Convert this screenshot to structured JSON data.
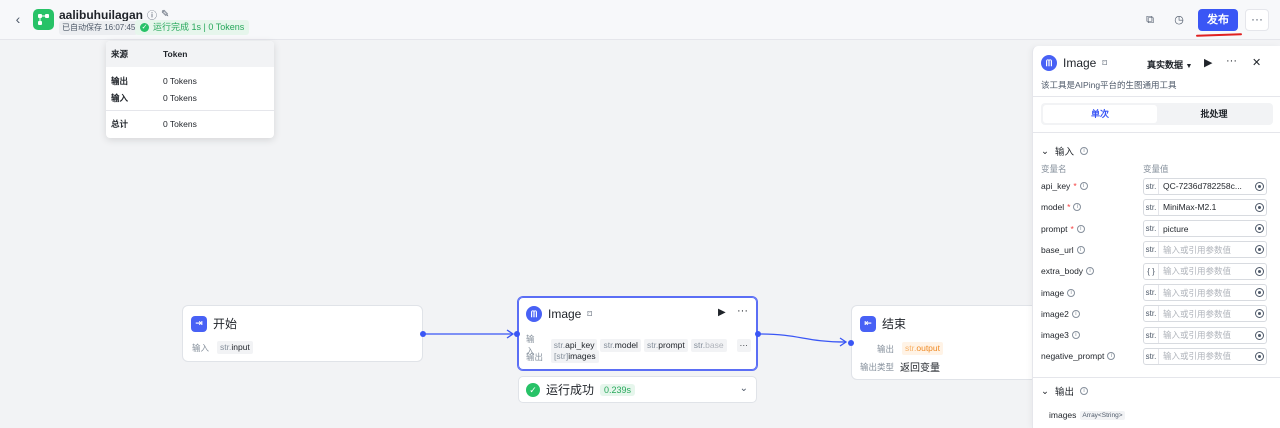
{
  "header": {
    "title": "aalibuhuilagan",
    "autosave": "已自动保存 16:07:45",
    "run_status": "运行完成 1s | 0 Tokens",
    "publish_label": "发布"
  },
  "token_popover": {
    "col_source": "来源",
    "col_token": "Token",
    "rows": [
      {
        "label": "输出",
        "value": "0 Tokens"
      },
      {
        "label": "输入",
        "value": "0 Tokens"
      }
    ],
    "total_label": "总计",
    "total_value": "0 Tokens"
  },
  "nodes": {
    "start": {
      "title": "开始",
      "input_label": "输入",
      "input_param": {
        "type": "str.",
        "name": "input"
      }
    },
    "image": {
      "title": "Image",
      "input_label": "输入",
      "output_label": "输出",
      "inputs": [
        {
          "type": "str.",
          "name": "api_key"
        },
        {
          "type": "str.",
          "name": "model"
        },
        {
          "type": "str.",
          "name": "prompt"
        },
        {
          "type": "str.",
          "name": "base"
        }
      ],
      "more": "···",
      "output": {
        "type": "[str]",
        "name": "images"
      }
    },
    "end": {
      "title": "结束",
      "output_label": "输出",
      "output_param": {
        "type": "str.",
        "name": "output"
      },
      "output_type_label": "输出类型",
      "output_type_value": "返回变量"
    }
  },
  "run_result": {
    "label": "运行成功",
    "time": "0.239s"
  },
  "panel": {
    "title": "Image",
    "data_mode": "真实数据",
    "description": "该工具是AIPing平台的生图通用工具",
    "tabs": [
      "单次",
      "批处理"
    ],
    "active_tab": 0,
    "input_section": "输入",
    "col_name": "变量名",
    "col_value": "变量值",
    "params": [
      {
        "name": "api_key",
        "required": true,
        "type": "str.",
        "value": "QC-7236d782258c...",
        "placeholder": ""
      },
      {
        "name": "model",
        "required": true,
        "type": "str.",
        "value": "MiniMax-M2.1",
        "placeholder": ""
      },
      {
        "name": "prompt",
        "required": true,
        "type": "str.",
        "value": "picture",
        "placeholder": ""
      },
      {
        "name": "base_url",
        "required": false,
        "type": "str.",
        "value": "",
        "placeholder": "输入或引用参数值"
      },
      {
        "name": "extra_body",
        "required": false,
        "type": "{ }",
        "value": "",
        "placeholder": "输入或引用参数值"
      },
      {
        "name": "image",
        "required": false,
        "type": "str.",
        "value": "",
        "placeholder": "输入或引用参数值"
      },
      {
        "name": "image2",
        "required": false,
        "type": "str.",
        "value": "",
        "placeholder": "输入或引用参数值"
      },
      {
        "name": "image3",
        "required": false,
        "type": "str.",
        "value": "",
        "placeholder": "输入或引用参数值"
      },
      {
        "name": "negative_prompt",
        "required": false,
        "type": "str.",
        "value": "",
        "placeholder": "输入或引用参数值"
      }
    ],
    "output_section": "输出",
    "output_var": "images",
    "output_type": "Array<String>"
  },
  "colors": {
    "accent": "#3a56f5",
    "success": "#27c267",
    "start_icon": "#4861f5",
    "publish_mark": "#e02020"
  }
}
